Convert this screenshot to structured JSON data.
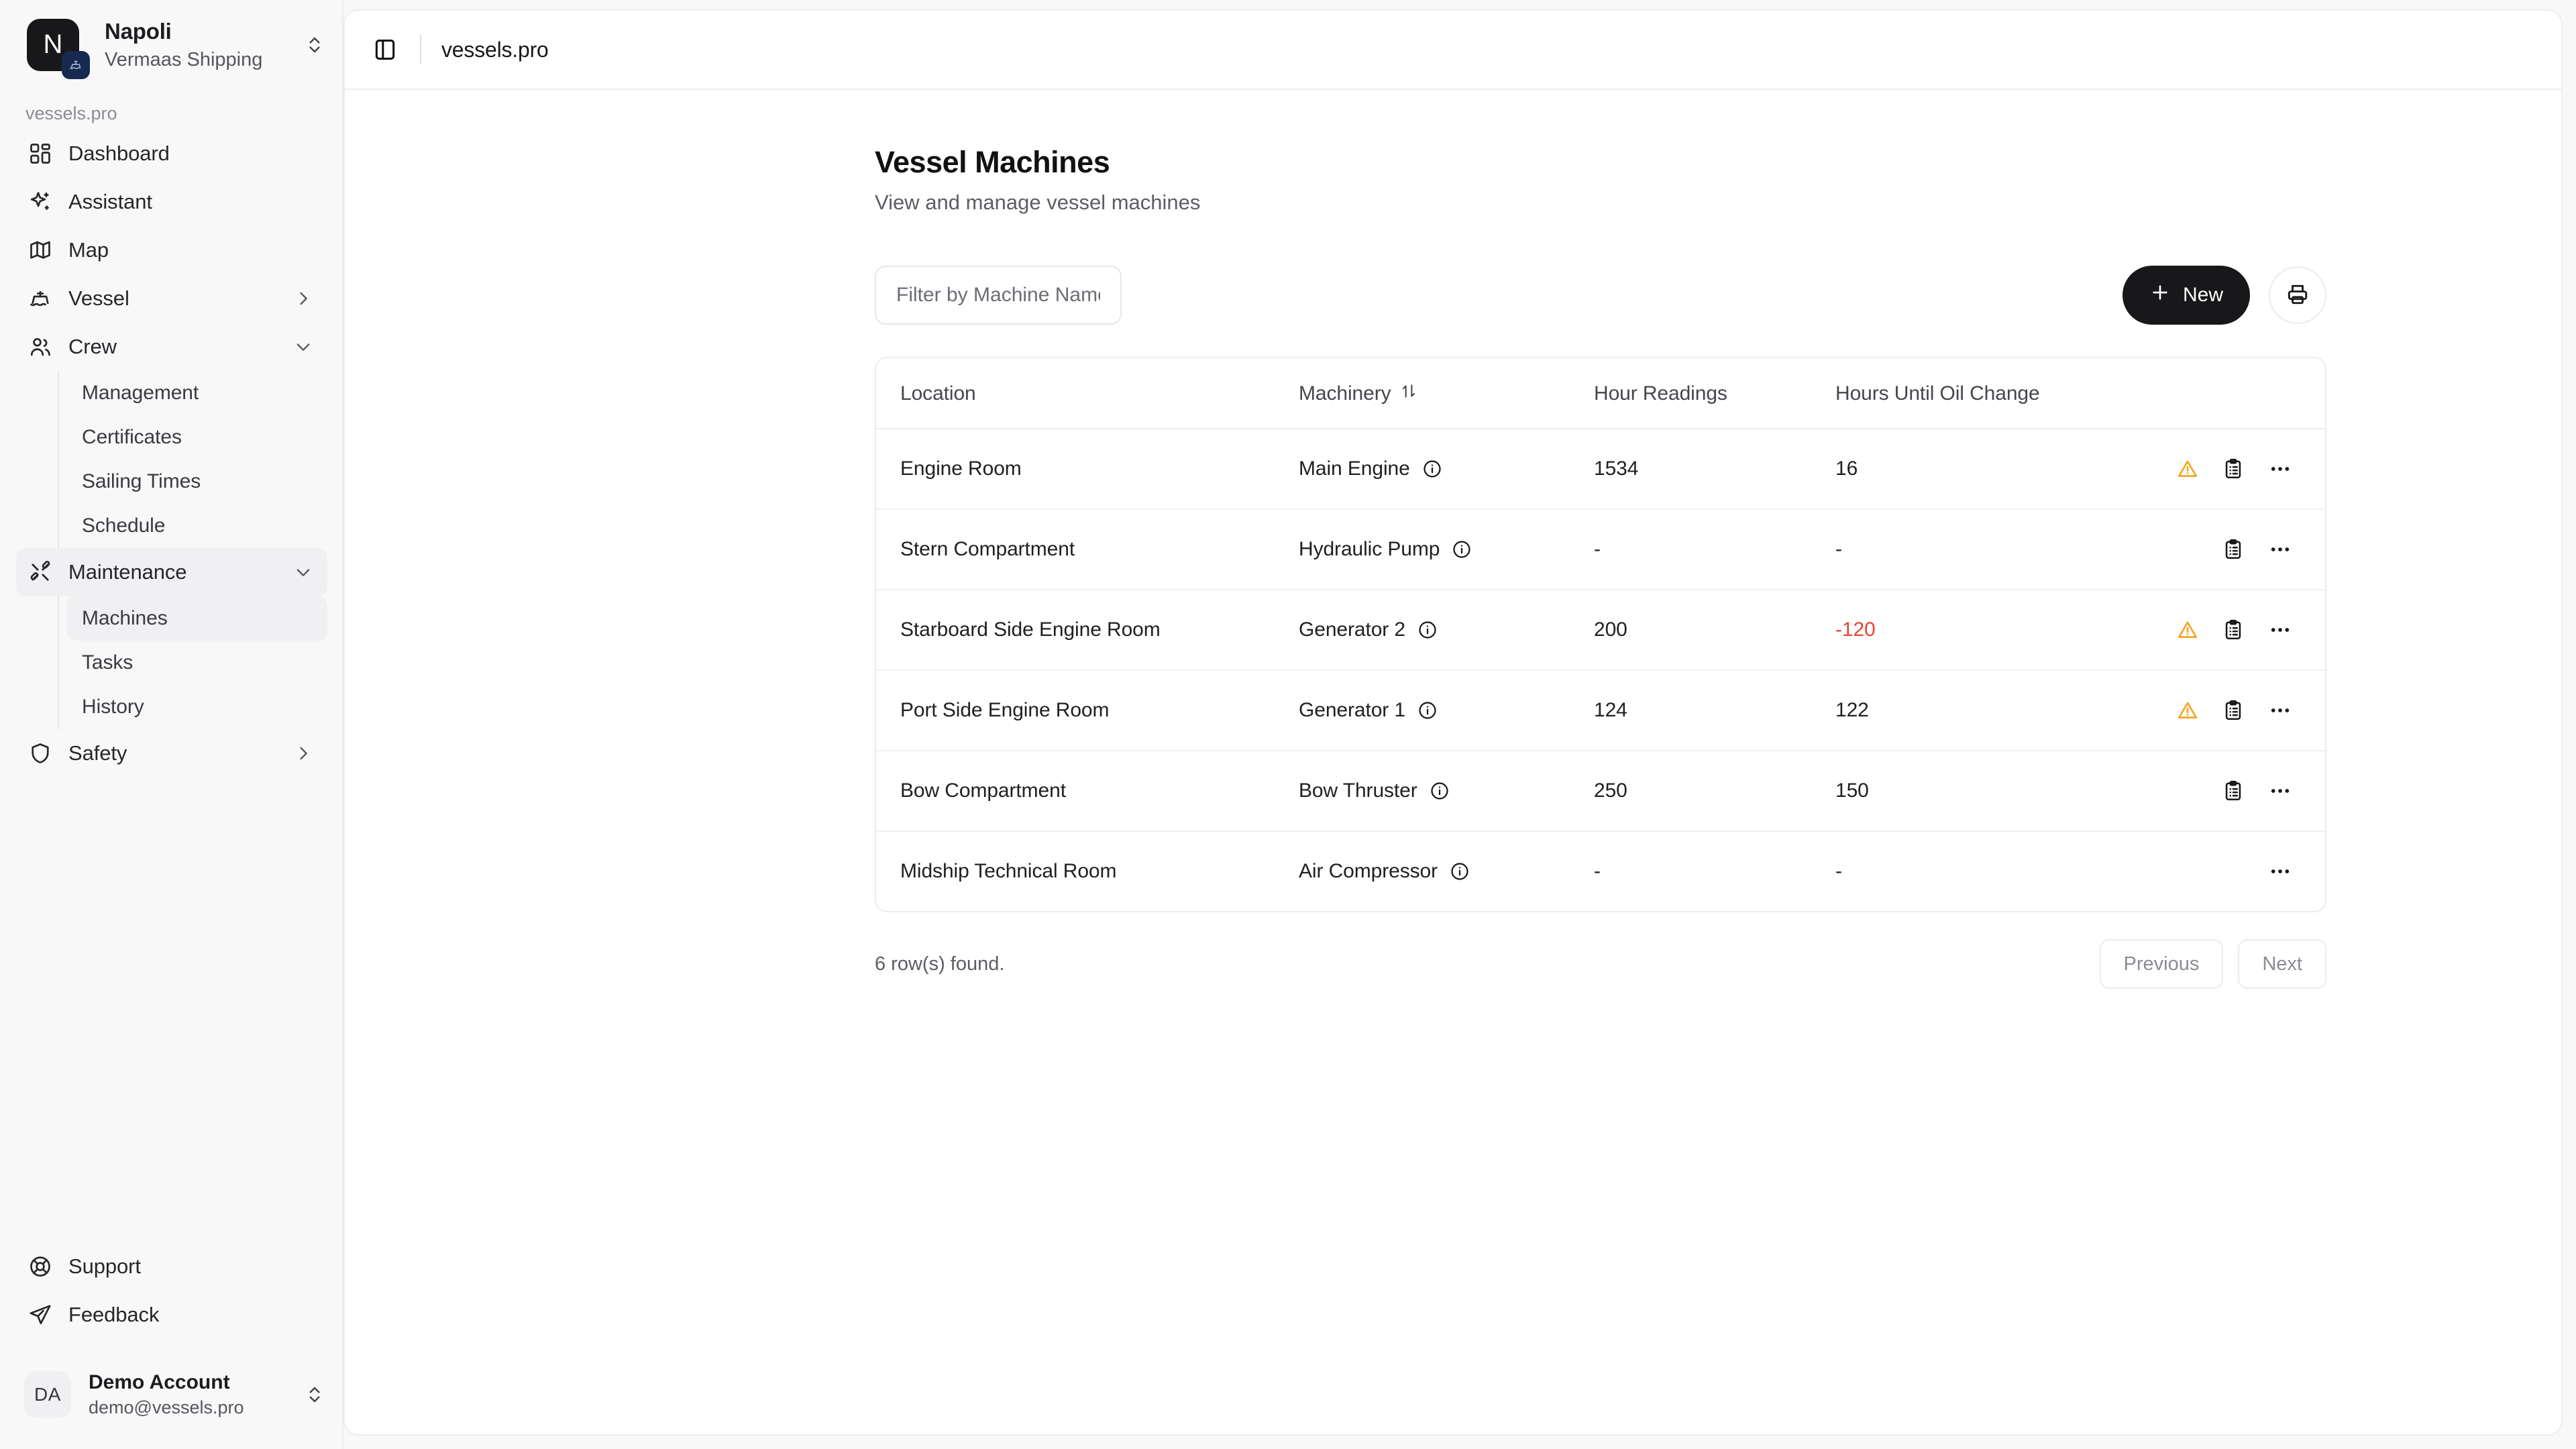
{
  "sidebar": {
    "org": {
      "initial": "N",
      "name": "Napoli",
      "subtitle": "Vermaas Shipping"
    },
    "section_label": "vessels.pro",
    "nav": [
      {
        "label": "Dashboard",
        "icon": "dashboard-icon",
        "caret": "none"
      },
      {
        "label": "Assistant",
        "icon": "sparkles-icon",
        "caret": "none"
      },
      {
        "label": "Map",
        "icon": "map-icon",
        "caret": "none"
      },
      {
        "label": "Vessel",
        "icon": "ship-icon",
        "caret": "right"
      },
      {
        "label": "Crew",
        "icon": "users-icon",
        "caret": "down"
      },
      {
        "label": "Maintenance",
        "icon": "wrench-icon",
        "caret": "down"
      },
      {
        "label": "Safety",
        "icon": "shield-icon",
        "caret": "right"
      }
    ],
    "crew_children": [
      "Management",
      "Certificates",
      "Sailing Times",
      "Schedule"
    ],
    "maintenance_children": [
      "Machines",
      "Tasks",
      "History"
    ],
    "active_child": "Machines",
    "bottom": [
      {
        "label": "Support",
        "icon": "lifebuoy-icon"
      },
      {
        "label": "Feedback",
        "icon": "send-icon"
      }
    ],
    "user": {
      "initials": "DA",
      "name": "Demo Account",
      "email": "demo@vessels.pro"
    }
  },
  "topbar": {
    "title": "vessels.pro",
    "toggle_icon": "sidebar-toggle-icon"
  },
  "page": {
    "title": "Vessel Machines",
    "subtitle": "View and manage vessel machines"
  },
  "toolbar": {
    "filter_placeholder": "Filter by Machine Name.",
    "filter_value": "",
    "new_label": "New",
    "print_icon": "printer-icon"
  },
  "table": {
    "columns": [
      "Location",
      "Machinery",
      "Hour Readings",
      "Hours Until Oil Change"
    ],
    "sort_column": "Machinery",
    "rows": [
      {
        "location": "Engine Room",
        "machinery": "Main Engine",
        "hour_readings": "1534",
        "hours_until_oil_change": "16",
        "oil_negative": false,
        "has_warning": true,
        "has_clipboard": true
      },
      {
        "location": "Stern Compartment",
        "machinery": "Hydraulic Pump",
        "hour_readings": "-",
        "hours_until_oil_change": "-",
        "oil_negative": false,
        "has_warning": false,
        "has_clipboard": true
      },
      {
        "location": "Starboard Side Engine Room",
        "machinery": "Generator 2",
        "hour_readings": "200",
        "hours_until_oil_change": "-120",
        "oil_negative": true,
        "has_warning": true,
        "has_clipboard": true
      },
      {
        "location": "Port Side Engine Room",
        "machinery": "Generator 1",
        "hour_readings": "124",
        "hours_until_oil_change": "122",
        "oil_negative": false,
        "has_warning": true,
        "has_clipboard": true
      },
      {
        "location": "Bow Compartment",
        "machinery": "Bow Thruster",
        "hour_readings": "250",
        "hours_until_oil_change": "150",
        "oil_negative": false,
        "has_warning": false,
        "has_clipboard": true
      },
      {
        "location": "Midship Technical Room",
        "machinery": "Air Compressor",
        "hour_readings": "-",
        "hours_until_oil_change": "-",
        "oil_negative": false,
        "has_warning": false,
        "has_clipboard": false
      }
    ]
  },
  "footer": {
    "rows_found": "6 row(s) found.",
    "previous_label": "Previous",
    "next_label": "Next"
  },
  "colors": {
    "accent_dark": "#18181b",
    "warning": "#f5a623",
    "danger": "#ea4335",
    "sidebar_bg": "#f8f8f9",
    "card_bg": "#ffffff"
  }
}
